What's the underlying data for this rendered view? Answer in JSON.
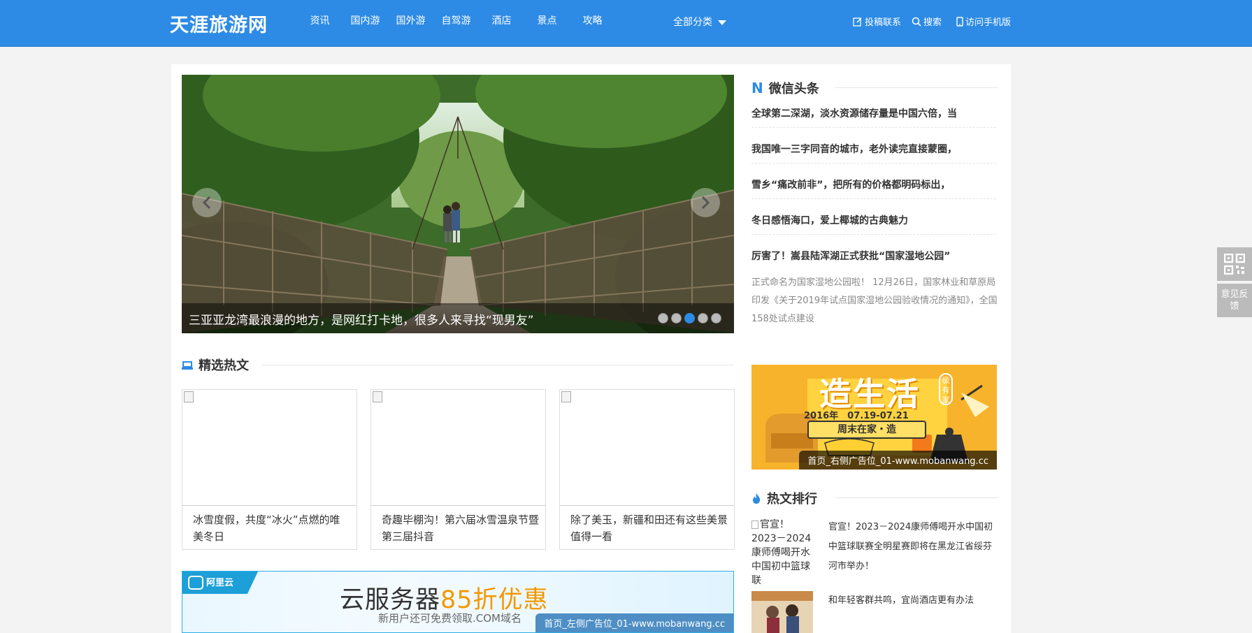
{
  "header": {
    "logo": "天涯旅游网",
    "nav": [
      "资讯",
      "国内游",
      "国外游",
      "自驾游",
      "酒店",
      "景点",
      "攻略"
    ],
    "all_categories": "全部分类",
    "contribute": "投稿联系",
    "search": "搜索",
    "mobile": "访问手机版"
  },
  "slider": {
    "caption": "三亚亚龙湾最浪漫的地方，是网红打卡地，很多人来寻找“现男友”",
    "dot_count": 5,
    "active_dot": 3
  },
  "featured": {
    "title": "精选热文",
    "cards": [
      {
        "text": "冰雪度假，共度“冰火”点燃的唯美冬日"
      },
      {
        "text": "奇趣毕棚沟！第六届冰雪温泉节暨第三届抖音"
      },
      {
        "text": "除了美玉，新疆和田还有这些美景值得一看"
      }
    ]
  },
  "ad_left": {
    "logo_text": "阿里云",
    "headline_prefix": "云服务器",
    "headline_highlight": "85折优惠",
    "subline": "新用户还可免费领取.COM域名",
    "tag": "首页_左侧广告位_01-www.mobanwang.cc"
  },
  "wechat": {
    "title_prefix": "N",
    "title": "微信头条",
    "items": [
      "全球第二深湖，淡水资源储存量是中国六倍，当",
      "我国唯一三字同音的城市，老外读完直接蒙圈，",
      "雪乡“痛改前非”，把所有的价格都明码标出，",
      "冬日感悟海口，爱上椰城的古典魅力",
      "厉害了！嵩县陆浑湖正式获批“国家湿地公园”"
    ],
    "description": "正式命名为国家湿地公园啦！ 12月26日，国家林业和草原局印发《关于2019年试点国家湿地公园验收情况的通知》，全国158处试点建设"
  },
  "ad_right": {
    "title": "造生活",
    "badge": "极有家",
    "date": "2016年　07.19-07.21",
    "sub": "周末在家・造",
    "tag": "首页_右侧广告位_01-www.mobanwang.cc"
  },
  "hot": {
    "title": "热文排行",
    "items": [
      {
        "thumb_alt": "官宣！2023－2024康师傅喝开水中国初中篮球联",
        "text": "官宣！2023－2024康师傅喝开水中国初中篮球联赛全明星赛即将在黑龙江省绥芬河市举办！"
      },
      {
        "thumb_alt": "",
        "text": "和年轻客群共鸣，宜尚酒店更有办法"
      }
    ]
  },
  "float": {
    "feedback": "意见反馈"
  },
  "colors": {
    "brand": "#2d8be5",
    "ad_accent": "#f39800"
  }
}
